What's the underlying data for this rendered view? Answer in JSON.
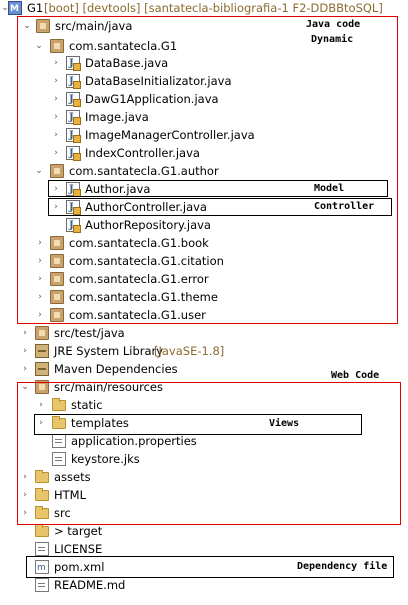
{
  "project": {
    "name": "G1",
    "decoration": "[boot] [devtools] [santatecla-bibliografia-1 F2-DDBBtoSQL]"
  },
  "tree": {
    "src_main_java": "src/main/java",
    "pkg_g1": "com.santatecla.G1",
    "files_g1": [
      "DataBase.java",
      "DataBaseInitializator.java",
      "DawG1Application.java",
      "Image.java",
      "ImageManagerController.java",
      "IndexController.java"
    ],
    "pkg_author": "com.santatecla.G1.author",
    "author_java": "Author.java",
    "author_controller": "AuthorController.java",
    "author_repository": "AuthorRepository.java",
    "pkgs_more": [
      "com.santatecla.G1.book",
      "com.santatecla.G1.citation",
      "com.santatecla.G1.error",
      "com.santatecla.G1.theme",
      "com.santatecla.G1.user"
    ],
    "src_test_java": "src/test/java",
    "jre_label": "JRE System Library",
    "jre_decoration": "[JavaSE-1.8]",
    "maven_deps": "Maven Dependencies",
    "src_main_resources": "src/main/resources",
    "static": "static",
    "templates": "templates",
    "application_properties": "application.properties",
    "keystore": "keystore.jks",
    "assets": "assets",
    "html": "HTML",
    "src": "src",
    "target": "> target",
    "license": "LICENSE",
    "pom": "pom.xml",
    "readme": "README.md"
  },
  "annotations": {
    "java_code": "Java code",
    "dynamic": "Dynamic",
    "model": "Model",
    "controller": "Controller",
    "web_code": "Web Code",
    "views": "Views",
    "dependency_file": "Dependency file"
  },
  "colors": {
    "annotation_box": "#e00000",
    "highlight_box": "#000000"
  }
}
